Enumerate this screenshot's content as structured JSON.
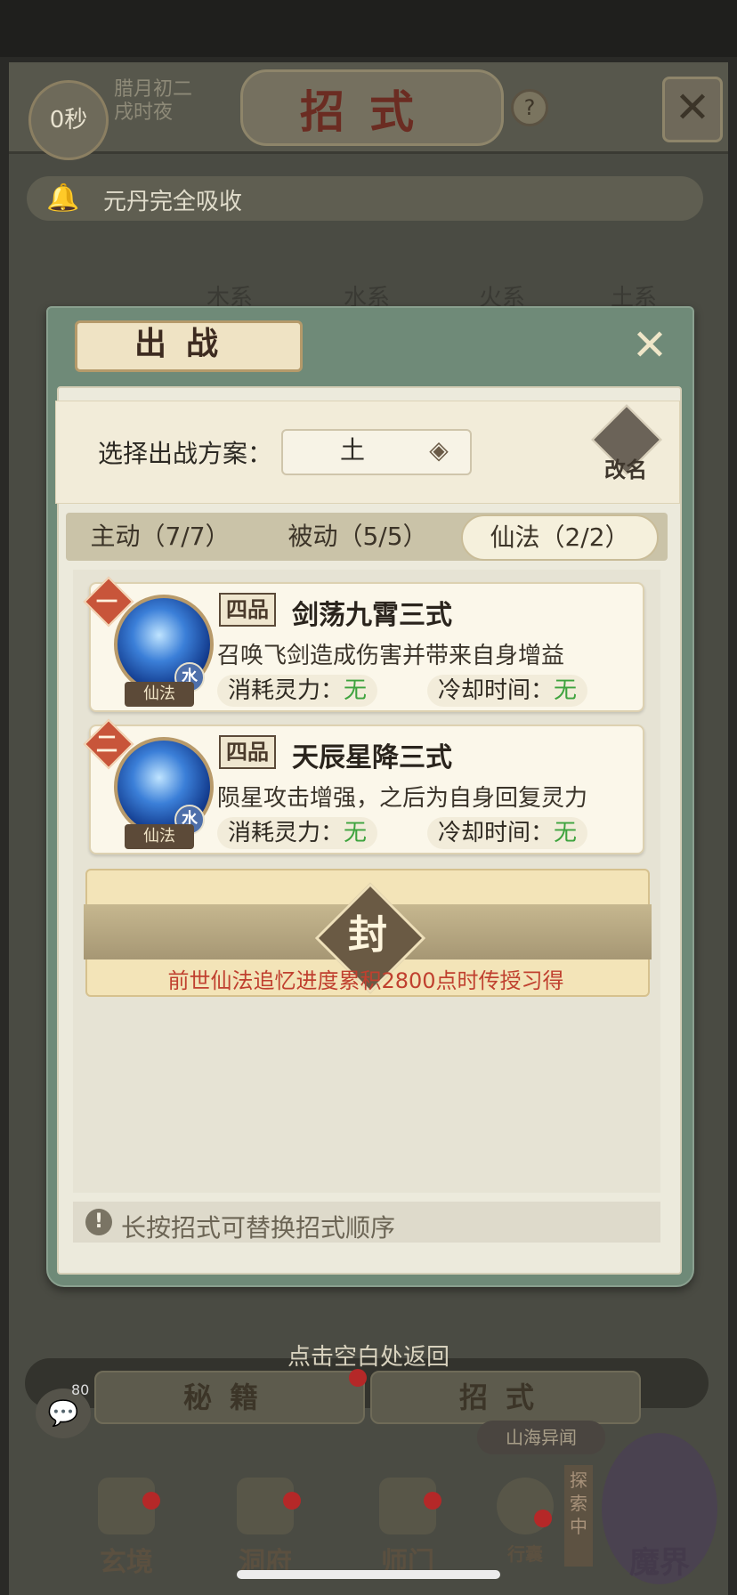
{
  "background": {
    "timer": "0秒",
    "lunar_line1": "腊月初二",
    "lunar_line2": "戌时夜",
    "title": "招式",
    "help": "?",
    "absorb_text": "元丹完全吸收",
    "element_tabs": [
      "木系",
      "水系",
      "火系",
      "土系"
    ],
    "bottom_tabs": [
      "秘籍",
      "招式"
    ],
    "chat_badge": "80",
    "shanhai": "山海异闻",
    "explore": "探索中",
    "nav": [
      "玄境",
      "洞府",
      "师门",
      "行囊",
      "魔界"
    ]
  },
  "modal": {
    "title": "出战",
    "plan_label": "选择出战方案：",
    "plan_value": "土",
    "rename": "改名",
    "tabs": [
      {
        "label": "主动（7/7）",
        "active": false
      },
      {
        "label": "被动（5/5）",
        "active": false
      },
      {
        "label": "仙法（2/2）",
        "active": true
      }
    ],
    "skills": [
      {
        "rank": "一",
        "grade": "四品",
        "name": "剑荡九霄三式",
        "desc": "召唤飞剑造成伤害并带来自身增益",
        "type": "仙法",
        "element": "水",
        "cost_label": "消耗灵力：",
        "cost_value": "无",
        "cd_label": "冷却时间：",
        "cd_value": "无"
      },
      {
        "rank": "二",
        "grade": "四品",
        "name": "天辰星降三式",
        "desc": "陨星攻击增强，之后为自身回复灵力",
        "type": "仙法",
        "element": "水",
        "cost_label": "消耗灵力：",
        "cost_value": "无",
        "cd_label": "冷却时间：",
        "cd_value": "无"
      }
    ],
    "sealed_char": "封",
    "sealed_note": "前世仙法追忆进度累积2800点时传授习得",
    "hint": "长按招式可替换招式顺序"
  },
  "tap_return": "点击空白处返回",
  "colors": {
    "seal_note": "#c0402f",
    "stat_value": "#3ea33e",
    "rank": "#c8553a"
  }
}
